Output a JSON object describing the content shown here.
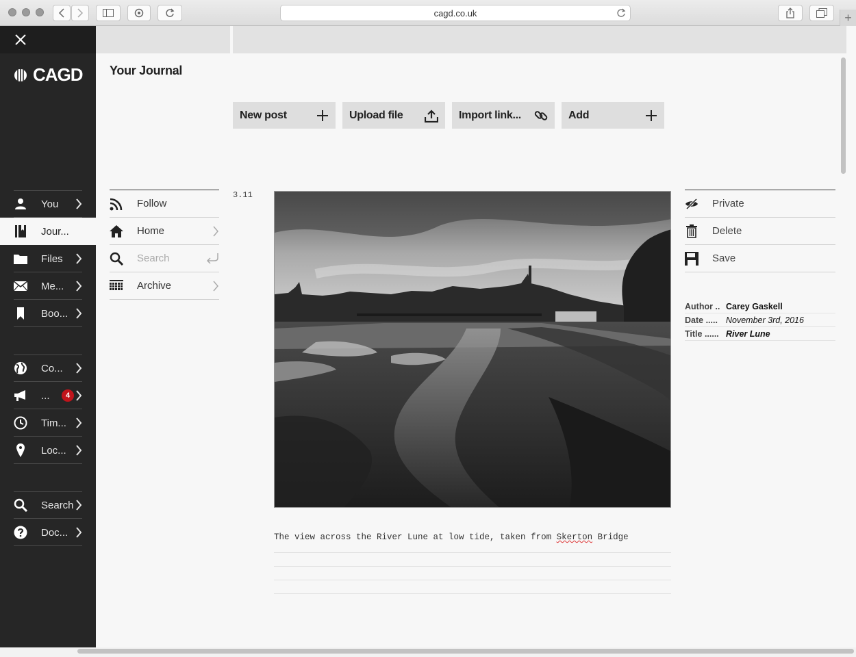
{
  "browser": {
    "url": "cagd.co.uk",
    "new_tab": "+"
  },
  "brand": {
    "logo_text": "CAGD"
  },
  "sidebar": {
    "groups": [
      [
        {
          "label": "You",
          "icon": "person-icon",
          "chevron": true
        },
        {
          "label": "Jour...",
          "icon": "journal-icon",
          "active": true,
          "chevron": false
        },
        {
          "label": "Files",
          "icon": "folder-icon",
          "chevron": true
        },
        {
          "label": "Me...",
          "icon": "envelope-icon",
          "chevron": true
        },
        {
          "label": "Boo...",
          "icon": "bookmark-icon",
          "chevron": true
        }
      ],
      [
        {
          "label": "Co...",
          "icon": "globe-icon",
          "chevron": true
        },
        {
          "label": "...",
          "icon": "megaphone-icon",
          "badge": "4",
          "chevron": true
        },
        {
          "label": "Tim...",
          "icon": "clock-icon",
          "chevron": true
        },
        {
          "label": "Loc...",
          "icon": "pin-icon",
          "chevron": true
        }
      ],
      [
        {
          "label": "Search",
          "icon": "search-icon",
          "chevron": true
        },
        {
          "label": "Doc...",
          "icon": "help-icon",
          "chevron": true
        }
      ]
    ]
  },
  "page": {
    "title": "Your Journal"
  },
  "actions": [
    {
      "label": "New post",
      "icon": "plus-icon"
    },
    {
      "label": "Upload file",
      "icon": "upload-icon"
    },
    {
      "label": "Import link...",
      "icon": "link-icon"
    },
    {
      "label": "Add",
      "icon": "plus-icon"
    }
  ],
  "subnav": [
    {
      "label": "Follow",
      "icon": "rss-icon"
    },
    {
      "label": "Home",
      "icon": "home-icon"
    },
    {
      "label": "Search",
      "icon": "search-icon"
    },
    {
      "label": "Archive",
      "icon": "archive-icon"
    }
  ],
  "post": {
    "number": "3.11",
    "caption_before": "The view across the River Lune at low tide, taken from ",
    "caption_misspelled": "Skerton",
    "caption_after": " Bridge"
  },
  "rpanel": [
    {
      "label": "Private",
      "icon": "eye-slash-icon"
    },
    {
      "label": "Delete",
      "icon": "trash-icon"
    },
    {
      "label": "Save",
      "icon": "floppy-icon"
    }
  ],
  "meta": [
    {
      "key": "Author ..",
      "value": "Carey Gaskell",
      "style": "b"
    },
    {
      "key": "Date .....",
      "value": "November 3rd, 2016",
      "style": "i"
    },
    {
      "key": "Title ......",
      "value": "River Lune",
      "style": "bi"
    }
  ],
  "colors": {
    "sidebar_bg": "#262626",
    "badge_red": "#c0141b",
    "button_gray": "#dedede"
  }
}
